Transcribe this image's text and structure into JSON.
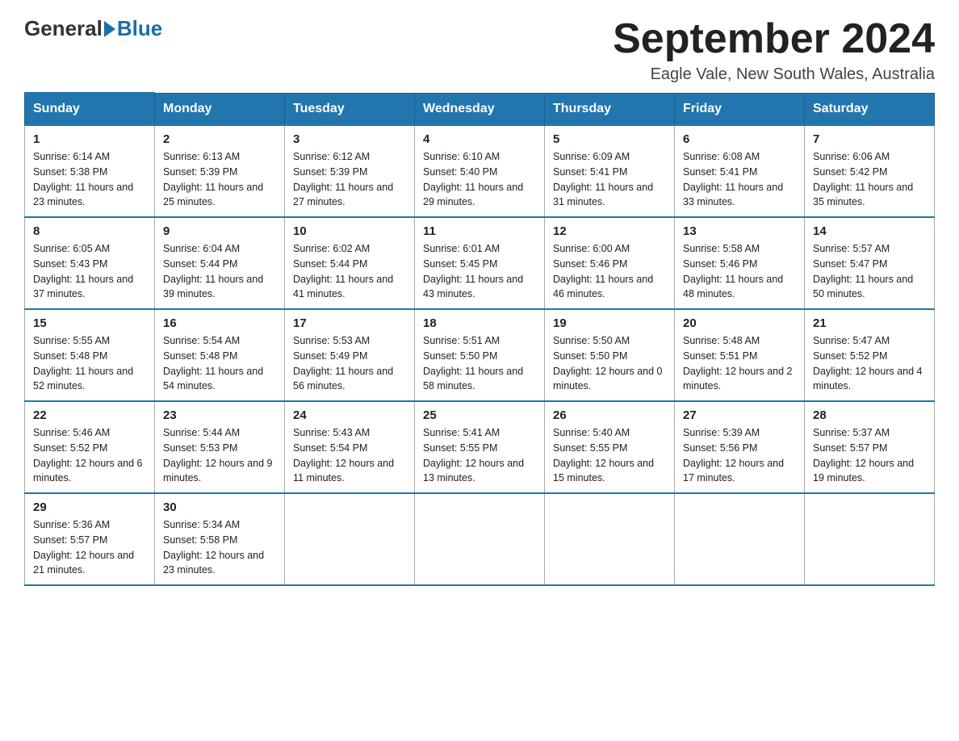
{
  "header": {
    "logo_general": "General",
    "logo_blue": "Blue",
    "month_title": "September 2024",
    "location": "Eagle Vale, New South Wales, Australia"
  },
  "days_of_week": [
    "Sunday",
    "Monday",
    "Tuesday",
    "Wednesday",
    "Thursday",
    "Friday",
    "Saturday"
  ],
  "weeks": [
    [
      {
        "day": "1",
        "sunrise": "6:14 AM",
        "sunset": "5:38 PM",
        "daylight": "11 hours and 23 minutes."
      },
      {
        "day": "2",
        "sunrise": "6:13 AM",
        "sunset": "5:39 PM",
        "daylight": "11 hours and 25 minutes."
      },
      {
        "day": "3",
        "sunrise": "6:12 AM",
        "sunset": "5:39 PM",
        "daylight": "11 hours and 27 minutes."
      },
      {
        "day": "4",
        "sunrise": "6:10 AM",
        "sunset": "5:40 PM",
        "daylight": "11 hours and 29 minutes."
      },
      {
        "day": "5",
        "sunrise": "6:09 AM",
        "sunset": "5:41 PM",
        "daylight": "11 hours and 31 minutes."
      },
      {
        "day": "6",
        "sunrise": "6:08 AM",
        "sunset": "5:41 PM",
        "daylight": "11 hours and 33 minutes."
      },
      {
        "day": "7",
        "sunrise": "6:06 AM",
        "sunset": "5:42 PM",
        "daylight": "11 hours and 35 minutes."
      }
    ],
    [
      {
        "day": "8",
        "sunrise": "6:05 AM",
        "sunset": "5:43 PM",
        "daylight": "11 hours and 37 minutes."
      },
      {
        "day": "9",
        "sunrise": "6:04 AM",
        "sunset": "5:44 PM",
        "daylight": "11 hours and 39 minutes."
      },
      {
        "day": "10",
        "sunrise": "6:02 AM",
        "sunset": "5:44 PM",
        "daylight": "11 hours and 41 minutes."
      },
      {
        "day": "11",
        "sunrise": "6:01 AM",
        "sunset": "5:45 PM",
        "daylight": "11 hours and 43 minutes."
      },
      {
        "day": "12",
        "sunrise": "6:00 AM",
        "sunset": "5:46 PM",
        "daylight": "11 hours and 46 minutes."
      },
      {
        "day": "13",
        "sunrise": "5:58 AM",
        "sunset": "5:46 PM",
        "daylight": "11 hours and 48 minutes."
      },
      {
        "day": "14",
        "sunrise": "5:57 AM",
        "sunset": "5:47 PM",
        "daylight": "11 hours and 50 minutes."
      }
    ],
    [
      {
        "day": "15",
        "sunrise": "5:55 AM",
        "sunset": "5:48 PM",
        "daylight": "11 hours and 52 minutes."
      },
      {
        "day": "16",
        "sunrise": "5:54 AM",
        "sunset": "5:48 PM",
        "daylight": "11 hours and 54 minutes."
      },
      {
        "day": "17",
        "sunrise": "5:53 AM",
        "sunset": "5:49 PM",
        "daylight": "11 hours and 56 minutes."
      },
      {
        "day": "18",
        "sunrise": "5:51 AM",
        "sunset": "5:50 PM",
        "daylight": "11 hours and 58 minutes."
      },
      {
        "day": "19",
        "sunrise": "5:50 AM",
        "sunset": "5:50 PM",
        "daylight": "12 hours and 0 minutes."
      },
      {
        "day": "20",
        "sunrise": "5:48 AM",
        "sunset": "5:51 PM",
        "daylight": "12 hours and 2 minutes."
      },
      {
        "day": "21",
        "sunrise": "5:47 AM",
        "sunset": "5:52 PM",
        "daylight": "12 hours and 4 minutes."
      }
    ],
    [
      {
        "day": "22",
        "sunrise": "5:46 AM",
        "sunset": "5:52 PM",
        "daylight": "12 hours and 6 minutes."
      },
      {
        "day": "23",
        "sunrise": "5:44 AM",
        "sunset": "5:53 PM",
        "daylight": "12 hours and 9 minutes."
      },
      {
        "day": "24",
        "sunrise": "5:43 AM",
        "sunset": "5:54 PM",
        "daylight": "12 hours and 11 minutes."
      },
      {
        "day": "25",
        "sunrise": "5:41 AM",
        "sunset": "5:55 PM",
        "daylight": "12 hours and 13 minutes."
      },
      {
        "day": "26",
        "sunrise": "5:40 AM",
        "sunset": "5:55 PM",
        "daylight": "12 hours and 15 minutes."
      },
      {
        "day": "27",
        "sunrise": "5:39 AM",
        "sunset": "5:56 PM",
        "daylight": "12 hours and 17 minutes."
      },
      {
        "day": "28",
        "sunrise": "5:37 AM",
        "sunset": "5:57 PM",
        "daylight": "12 hours and 19 minutes."
      }
    ],
    [
      {
        "day": "29",
        "sunrise": "5:36 AM",
        "sunset": "5:57 PM",
        "daylight": "12 hours and 21 minutes."
      },
      {
        "day": "30",
        "sunrise": "5:34 AM",
        "sunset": "5:58 PM",
        "daylight": "12 hours and 23 minutes."
      },
      null,
      null,
      null,
      null,
      null
    ]
  ],
  "labels": {
    "sunrise": "Sunrise:",
    "sunset": "Sunset:",
    "daylight": "Daylight:"
  }
}
